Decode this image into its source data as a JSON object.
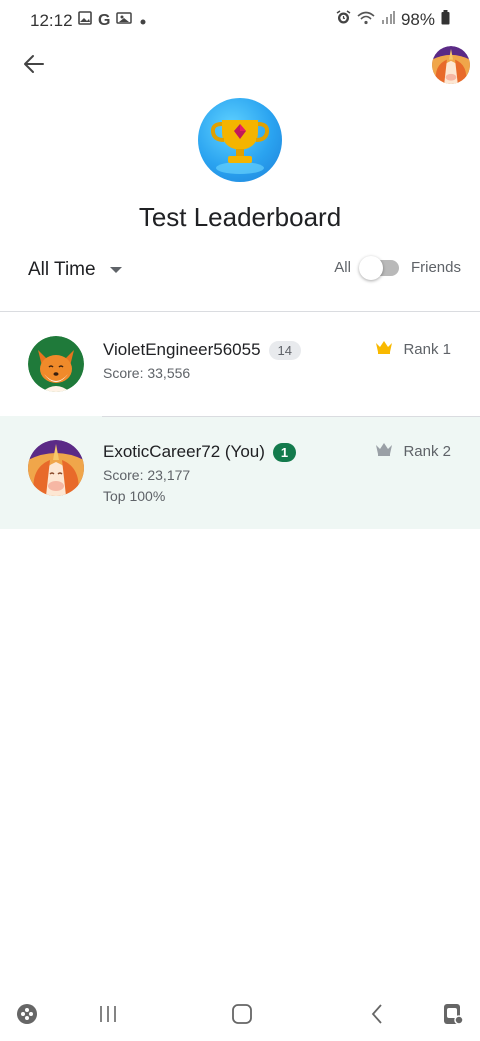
{
  "status_bar": {
    "time": "12:12",
    "g_letter": "G",
    "battery": "98%",
    "icons": [
      "image-icon",
      "google-icon",
      "gallery-icon",
      "dot-icon",
      "alarm-icon",
      "wifi-icon",
      "signal-icon",
      "battery-icon"
    ]
  },
  "app_bar": {
    "back_icon": "arrow-left-icon",
    "profile_icon": "unicorn-avatar-icon"
  },
  "header": {
    "title": "Test Leaderboard",
    "trophy_icon": "trophy-icon"
  },
  "filters": {
    "time_range": "All Time",
    "toggle_left": "All",
    "toggle_right": "Friends",
    "toggle_on": false
  },
  "players": [
    {
      "name": "VioletEngineer56055",
      "level": "14",
      "score": "Score: 33,556",
      "rank": "Rank 1",
      "avatar": "fox-avatar-icon",
      "crown_color": "#f9b900"
    },
    {
      "name": "ExoticCareer72 (You)",
      "level": "1",
      "score": "Score: 23,177",
      "top": "Top 100%",
      "rank": "Rank 2",
      "avatar": "unicorn-avatar-icon",
      "crown_color": "#9aa0a6",
      "highlight_color": "#eff7f4"
    }
  ],
  "colors": {
    "level_badge_you": "#137a4c",
    "divider": "#dadce0"
  },
  "nav_bar": {
    "icons": [
      "game-launcher-icon",
      "recents-icon",
      "home-icon",
      "back-icon",
      "game-booster-icon"
    ]
  }
}
